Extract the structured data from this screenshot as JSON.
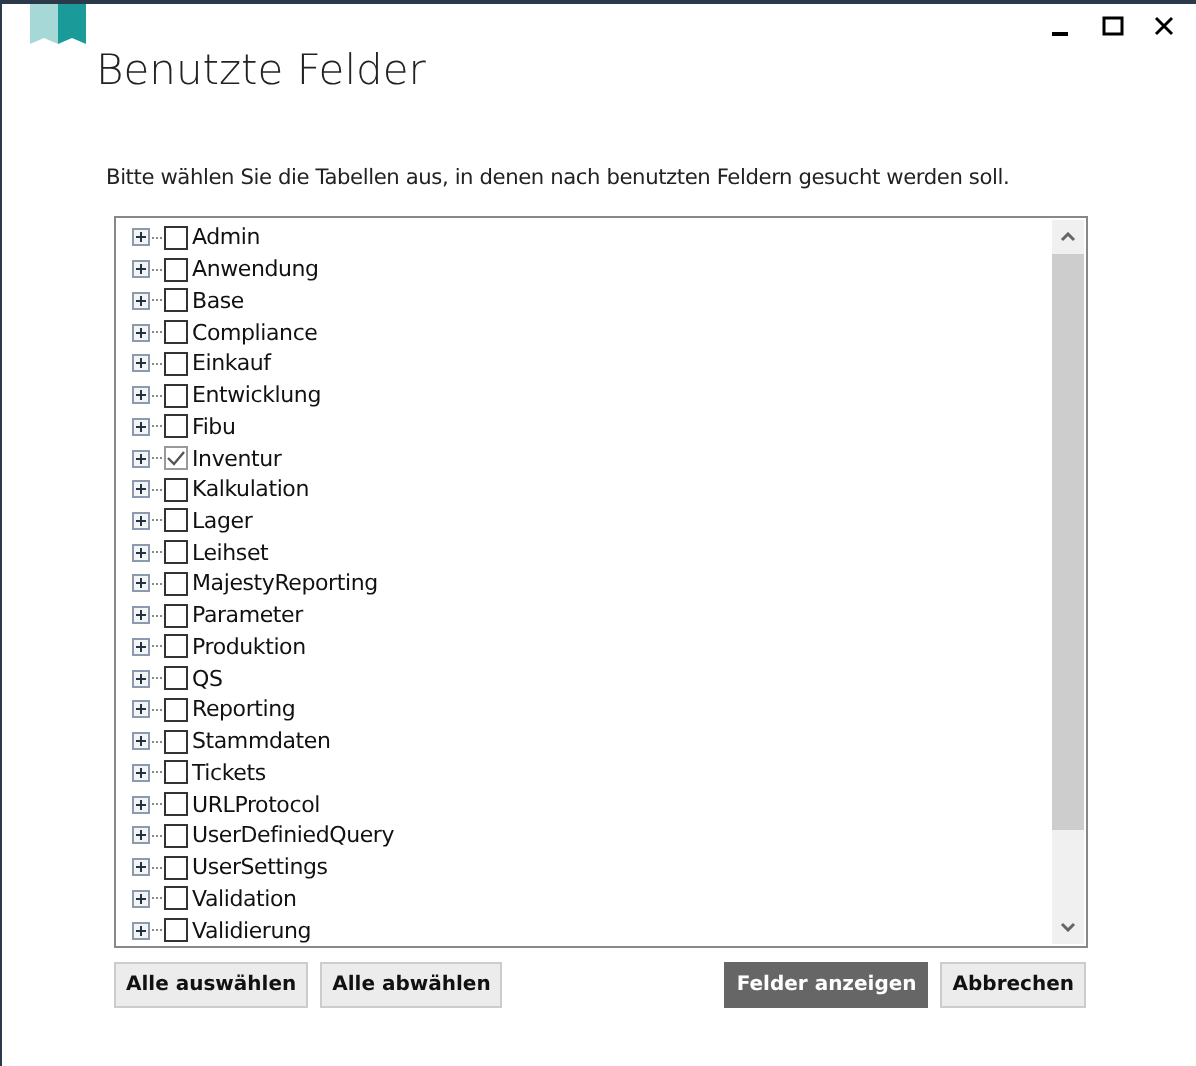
{
  "window": {
    "title": "Benutzte Felder"
  },
  "instruction": "Bitte wählen Sie die Tabellen aus, in denen nach benutzten Feldern gesucht werden soll.",
  "tree": {
    "items": [
      {
        "label": "Admin",
        "checked": false,
        "expanded": false
      },
      {
        "label": "Anwendung",
        "checked": false,
        "expanded": false
      },
      {
        "label": "Base",
        "checked": false,
        "expanded": false
      },
      {
        "label": "Compliance",
        "checked": false,
        "expanded": false
      },
      {
        "label": "Einkauf",
        "checked": false,
        "expanded": false
      },
      {
        "label": "Entwicklung",
        "checked": false,
        "expanded": false
      },
      {
        "label": "Fibu",
        "checked": false,
        "expanded": false
      },
      {
        "label": "Inventur",
        "checked": true,
        "expanded": false
      },
      {
        "label": "Kalkulation",
        "checked": false,
        "expanded": false
      },
      {
        "label": "Lager",
        "checked": false,
        "expanded": false
      },
      {
        "label": "Leihset",
        "checked": false,
        "expanded": false
      },
      {
        "label": "MajestyReporting",
        "checked": false,
        "expanded": false
      },
      {
        "label": "Parameter",
        "checked": false,
        "expanded": false
      },
      {
        "label": "Produktion",
        "checked": false,
        "expanded": false
      },
      {
        "label": "QS",
        "checked": false,
        "expanded": false
      },
      {
        "label": "Reporting",
        "checked": false,
        "expanded": false
      },
      {
        "label": "Stammdaten",
        "checked": false,
        "expanded": false
      },
      {
        "label": "Tickets",
        "checked": false,
        "expanded": false
      },
      {
        "label": "URLProtocol",
        "checked": false,
        "expanded": false
      },
      {
        "label": "UserDefiniedQuery",
        "checked": false,
        "expanded": false
      },
      {
        "label": "UserSettings",
        "checked": false,
        "expanded": false
      },
      {
        "label": "Validation",
        "checked": false,
        "expanded": false
      },
      {
        "label": "Validierung",
        "checked": false,
        "expanded": false
      }
    ]
  },
  "buttons_left": [
    {
      "label": "Alle auswählen",
      "primary": false
    },
    {
      "label": "Alle abwählen",
      "primary": false
    }
  ],
  "buttons_right": [
    {
      "label": "Felder anzeigen",
      "primary": true
    },
    {
      "label": "Abbrechen",
      "primary": false
    }
  ]
}
